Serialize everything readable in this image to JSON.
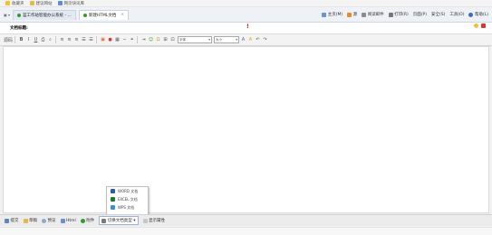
{
  "browser": {
    "favorites": [
      {
        "label": "收藏夹",
        "icon": "star-icon"
      },
      {
        "label": "建议网站",
        "icon": "folder-icon"
      },
      {
        "label": "网页快讯库",
        "icon": "page-icon"
      }
    ],
    "nav_label": "▣ ▾",
    "tabs": [
      {
        "label": "蓝工作站智能办公系统 - ...",
        "active": false
      },
      {
        "label": "新建HTML文档",
        "active": true
      }
    ],
    "commands": [
      {
        "label": "主页(M)",
        "icon": "home-icon"
      },
      {
        "label": "源",
        "icon": "feed-icon"
      },
      {
        "label": "阅读邮件",
        "icon": "mail-icon"
      },
      {
        "label": "打印(R)",
        "icon": "print-icon"
      },
      {
        "label": "页面(P)",
        "icon": "page-icon"
      },
      {
        "label": "安全(S)",
        "icon": "safety-icon"
      },
      {
        "label": "工具(O)",
        "icon": "tools-icon"
      },
      {
        "label": "帮助(L)",
        "icon": "help-icon"
      }
    ]
  },
  "document": {
    "title_label": "文档标题:",
    "title_value": "",
    "required_mark": "!"
  },
  "editor": {
    "source_label": "源码",
    "font_placeholder": "字体",
    "size_placeholder": "大小"
  },
  "popup": {
    "items": [
      {
        "label": "WORD 文档",
        "color": "#2b5cb3"
      },
      {
        "label": "EXCEL 文档",
        "color": "#1f7a3a"
      },
      {
        "label": "WPS 文档",
        "color": "#3a8fd6"
      }
    ]
  },
  "bottom": {
    "buttons": [
      {
        "label": "提交",
        "icon": "submit-icon"
      },
      {
        "label": "草稿",
        "icon": "draft-icon"
      },
      {
        "label": "预览",
        "icon": "preview-icon"
      },
      {
        "label": "Html",
        "icon": "html-icon"
      },
      {
        "label": "附件",
        "icon": "attachment-icon"
      }
    ],
    "convert_label": "切换文档类型",
    "props_label": "显示属性"
  },
  "colors": {
    "accent": "#2f9e2f",
    "required": "#e00000",
    "tab_border": "#c9d2dd"
  }
}
